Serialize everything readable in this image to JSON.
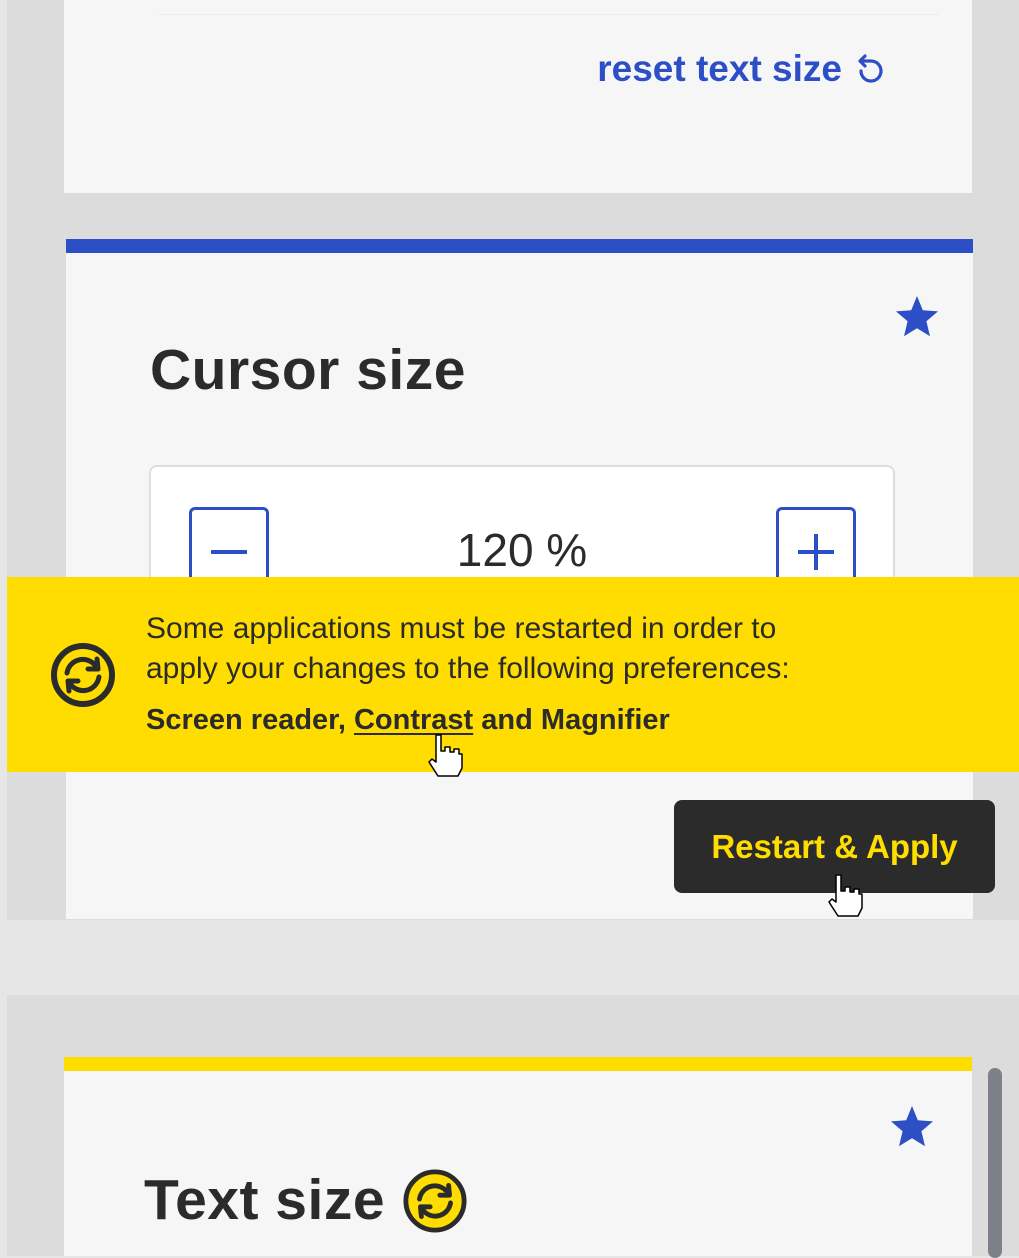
{
  "reset_link": {
    "label": "reset text size",
    "icon": "reset-icon",
    "color": "#2d4fc6"
  },
  "cursor_card": {
    "title": "Cursor size",
    "value": "120 %",
    "decrease_icon": "minus-icon",
    "increase_icon": "plus-icon",
    "favorite_icon": "star-icon",
    "accent": "#2d4fc6"
  },
  "banner": {
    "message": "Some applications must be restarted in order to apply your changes to the following preferences:",
    "pref_1": "Screen reader",
    "separator": ",",
    "pref_2": "Contrast",
    "conjunction": "and",
    "pref_3": "Magnifier",
    "icon": "restart-icon",
    "background": "#ffdd00"
  },
  "restart_button": {
    "label": "Restart & Apply"
  },
  "text_card": {
    "title": "Text size",
    "title_icon": "restart-icon",
    "favorite_icon": "star-icon",
    "accent": "#ffdd00"
  }
}
